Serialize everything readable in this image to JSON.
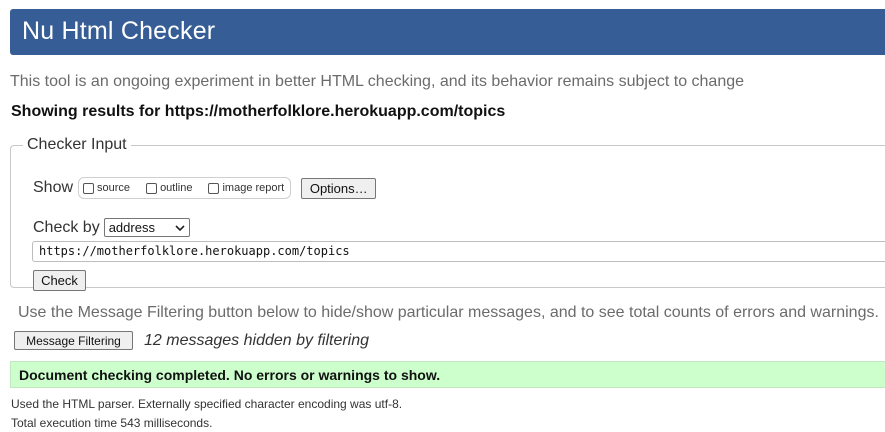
{
  "header": {
    "title": "Nu Html Checker",
    "color": "#365d95"
  },
  "intro": "This tool is an ongoing experiment in better HTML checking, and its behavior remains subject to change",
  "showing": "Showing results for https://motherfolklore.herokuapp.com/topics",
  "checker_input": {
    "legend": "Checker Input",
    "show_label": "Show",
    "options": [
      {
        "label": "source",
        "checked": false
      },
      {
        "label": "outline",
        "checked": false
      },
      {
        "label": "image report",
        "checked": false
      }
    ],
    "options_button": "Options…",
    "check_by_label": "Check by",
    "check_by_value": "address",
    "url_value": "https://motherfolklore.herokuapp.com/topics",
    "check_button": "Check"
  },
  "filter_note": "Use the Message Filtering button below to hide/show particular messages, and to see total counts of errors and warnings.",
  "filter_button": "Message Filtering",
  "hidden_count": "12 messages hidden by filtering",
  "result": {
    "message": "Document checking completed. No errors or warnings to show.",
    "color": "#ccffcc"
  },
  "footer": {
    "parser_line": "Used the HTML parser. Externally specified character encoding was utf-8.",
    "time_line": "Total execution time 543 milliseconds."
  }
}
